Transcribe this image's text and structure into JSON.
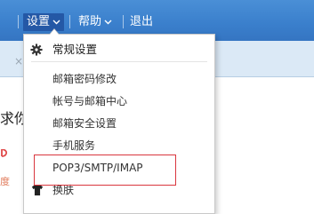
{
  "nav": {
    "settings_label": "设置",
    "help_label": "帮助",
    "logout_label": "退出"
  },
  "tab": {
    "close_glyph": "×"
  },
  "background": {
    "heading_partial": "求你",
    "small_text_partial": "度"
  },
  "menu": {
    "title": "常规设置",
    "items": [
      {
        "label": "邮箱密码修改"
      },
      {
        "label": "帐号与邮箱中心"
      },
      {
        "label": "邮箱安全设置"
      },
      {
        "label": "手机服务"
      },
      {
        "label": "POP3/SMTP/IMAP"
      },
      {
        "label": "换肤"
      }
    ]
  },
  "colors": {
    "nav_bg": "#3a7fcc",
    "nav_active_bg": "#2458a6",
    "highlight_border": "#d9363e"
  },
  "icons": {
    "settings": "gear-icon",
    "skin": "tshirt-icon",
    "dropdown": "chevron-down-icon",
    "close": "close-icon"
  }
}
